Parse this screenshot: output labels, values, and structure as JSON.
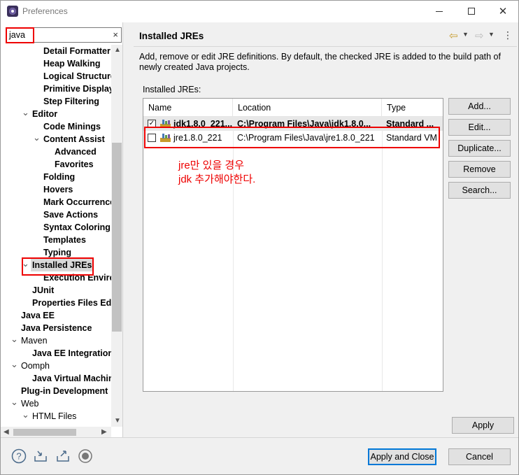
{
  "window": {
    "title": "Preferences"
  },
  "filter": {
    "value": "java",
    "clear_glyph": "×"
  },
  "tree": [
    {
      "label": "Detail Formatter",
      "indent": 3,
      "bold": true
    },
    {
      "label": "Heap Walking",
      "indent": 3,
      "bold": true
    },
    {
      "label": "Logical Structure",
      "indent": 3,
      "bold": true
    },
    {
      "label": "Primitive Display",
      "indent": 3,
      "bold": true
    },
    {
      "label": "Step Filtering",
      "indent": 3,
      "bold": true
    },
    {
      "label": "Editor",
      "indent": 2,
      "bold": true,
      "twisty": "expanded"
    },
    {
      "label": "Code Minings",
      "indent": 3,
      "bold": true
    },
    {
      "label": "Content Assist",
      "indent": 3,
      "bold": true,
      "twisty": "expanded"
    },
    {
      "label": "Advanced",
      "indent": 4,
      "bold": true
    },
    {
      "label": "Favorites",
      "indent": 4,
      "bold": true
    },
    {
      "label": "Folding",
      "indent": 3,
      "bold": true
    },
    {
      "label": "Hovers",
      "indent": 3,
      "bold": true
    },
    {
      "label": "Mark Occurrences",
      "indent": 3,
      "bold": true
    },
    {
      "label": "Save Actions",
      "indent": 3,
      "bold": true
    },
    {
      "label": "Syntax Coloring",
      "indent": 3,
      "bold": true
    },
    {
      "label": "Templates",
      "indent": 3,
      "bold": true
    },
    {
      "label": "Typing",
      "indent": 3,
      "bold": true
    },
    {
      "label": "Installed JREs",
      "indent": 2,
      "bold": true,
      "twisty": "expanded",
      "selected": true
    },
    {
      "label": "Execution Environments",
      "indent": 3,
      "bold": true
    },
    {
      "label": "JUnit",
      "indent": 2,
      "bold": true
    },
    {
      "label": "Properties Files Editor",
      "indent": 2,
      "bold": true
    },
    {
      "label": "Java EE",
      "indent": 1,
      "bold": true
    },
    {
      "label": "Java Persistence",
      "indent": 1,
      "bold": true
    },
    {
      "label": "Maven",
      "indent": 1,
      "bold": false,
      "twisty": "expanded"
    },
    {
      "label": "Java EE Integration",
      "indent": 2,
      "bold": true
    },
    {
      "label": "Oomph",
      "indent": 1,
      "bold": false,
      "twisty": "expanded"
    },
    {
      "label": "Java Virtual Machine",
      "indent": 2,
      "bold": true
    },
    {
      "label": "Plug-in Development",
      "indent": 1,
      "bold": true
    },
    {
      "label": "Web",
      "indent": 1,
      "bold": false,
      "twisty": "expanded"
    },
    {
      "label": "HTML Files",
      "indent": 2,
      "bold": false,
      "twisty": "expanded"
    }
  ],
  "page": {
    "title": "Installed JREs",
    "description": "Add, remove or edit JRE definitions. By default, the checked JRE is added to the build path of newly created Java projects.",
    "installed_label": "Installed JREs:",
    "columns": [
      "Name",
      "Location",
      "Type"
    ],
    "rows": [
      {
        "checked": true,
        "name": "jdk1.8.0_221...",
        "location": "C:\\Program Files\\Java\\jdk1.8.0...",
        "type": "Standard ...",
        "bold": true
      },
      {
        "checked": false,
        "name": "jre1.8.0_221",
        "location": "C:\\Program Files\\Java\\jre1.8.0_221",
        "type": "Standard VM",
        "bold": false
      }
    ],
    "annotation": [
      "jre만 있을 경우",
      "jdk 추가해야한다."
    ],
    "buttons": {
      "add": "Add...",
      "edit": "Edit...",
      "duplicate": "Duplicate...",
      "remove": "Remove",
      "search": "Search..."
    },
    "apply": "Apply"
  },
  "footer": {
    "apply_close": "Apply and Close",
    "cancel": "Cancel"
  },
  "colors": {
    "annotation_red": "#e00000",
    "default_button_border": "#0078d7"
  }
}
